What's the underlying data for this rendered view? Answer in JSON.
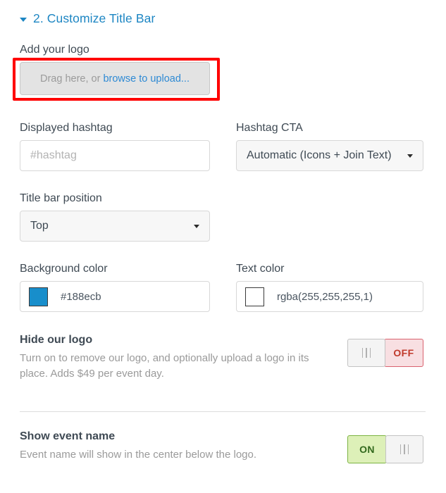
{
  "section": {
    "title": "2. Customize Title Bar",
    "caret_icon": "caret-down-icon",
    "accent_color": "#1d86c3",
    "expanded": true
  },
  "logo_upload": {
    "label": "Add your logo",
    "drag_text": "Drag here, or ",
    "link_text": "browse to upload...",
    "annotation_color": "#ff0000"
  },
  "hashtag": {
    "label": "Displayed hashtag",
    "value": "",
    "placeholder": "#hashtag"
  },
  "hashtag_cta": {
    "label": "Hashtag CTA",
    "value": "Automatic (Icons + Join Text)",
    "chevron_icon": "chevron-down-icon"
  },
  "title_bar_position": {
    "label": "Title bar position",
    "value": "Top",
    "chevron_icon": "chevron-down-icon"
  },
  "background_color": {
    "label": "Background color",
    "value": "#188ecb",
    "swatch_color": "#188ecb"
  },
  "text_color": {
    "label": "Text color",
    "value": "rgba(255,255,255,1)",
    "swatch_color": "#ffffff"
  },
  "hide_logo": {
    "title": "Hide our logo",
    "description": "Turn on to remove our logo, and optionally upload a logo in its place. Adds $49 per event day.",
    "state_label": "OFF",
    "state": "off",
    "off_color": "#c0392b"
  },
  "show_event_name": {
    "title": "Show event name",
    "description": "Event name will show in the center below the logo.",
    "state_label": "ON",
    "state": "on",
    "on_color": "#33691e"
  }
}
